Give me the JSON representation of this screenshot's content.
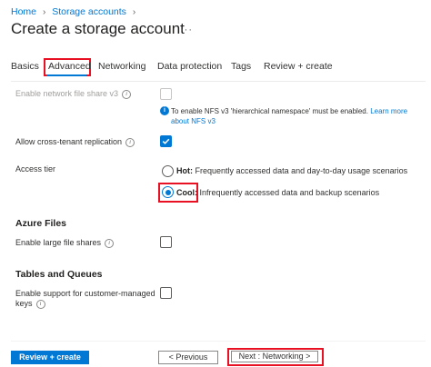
{
  "breadcrumb": {
    "home": "Home",
    "storage": "Storage accounts"
  },
  "page": {
    "title": "Create a storage account",
    "more": "···"
  },
  "tabs": [
    "Basics",
    "Advanced",
    "Networking",
    "Data protection",
    "Tags",
    "Review + create"
  ],
  "fields": {
    "nfs_label": "Enable network file share v3",
    "nfs_note": "To enable NFS v3 'hierarchical namespace' must be enabled.",
    "nfs_link": "Learn more about NFS v3",
    "cross_tenant_label": "Allow cross-tenant replication",
    "access_tier_label": "Access tier",
    "hot_title": "Hot:",
    "hot_desc": "Frequently accessed data and day-to-day usage scenarios",
    "cool_title": "Cool:",
    "cool_desc": "Infrequently accessed data and backup scenarios",
    "azure_files_heading": "Azure Files",
    "large_shares_label": "Enable large file shares",
    "tables_heading": "Tables and Queues",
    "cmk_label_1": "Enable support for customer-managed",
    "cmk_label_2": "keys"
  },
  "state": {
    "nfs_checked": false,
    "cross_tenant_checked": true,
    "access_tier": "Cool",
    "large_shares_checked": false,
    "cmk_checked": false
  },
  "footer": {
    "review": "Review + create",
    "previous": "< Previous",
    "next": "Next : Networking >"
  },
  "colors": {
    "accent": "#0078d4",
    "highlight": "#e81123"
  }
}
